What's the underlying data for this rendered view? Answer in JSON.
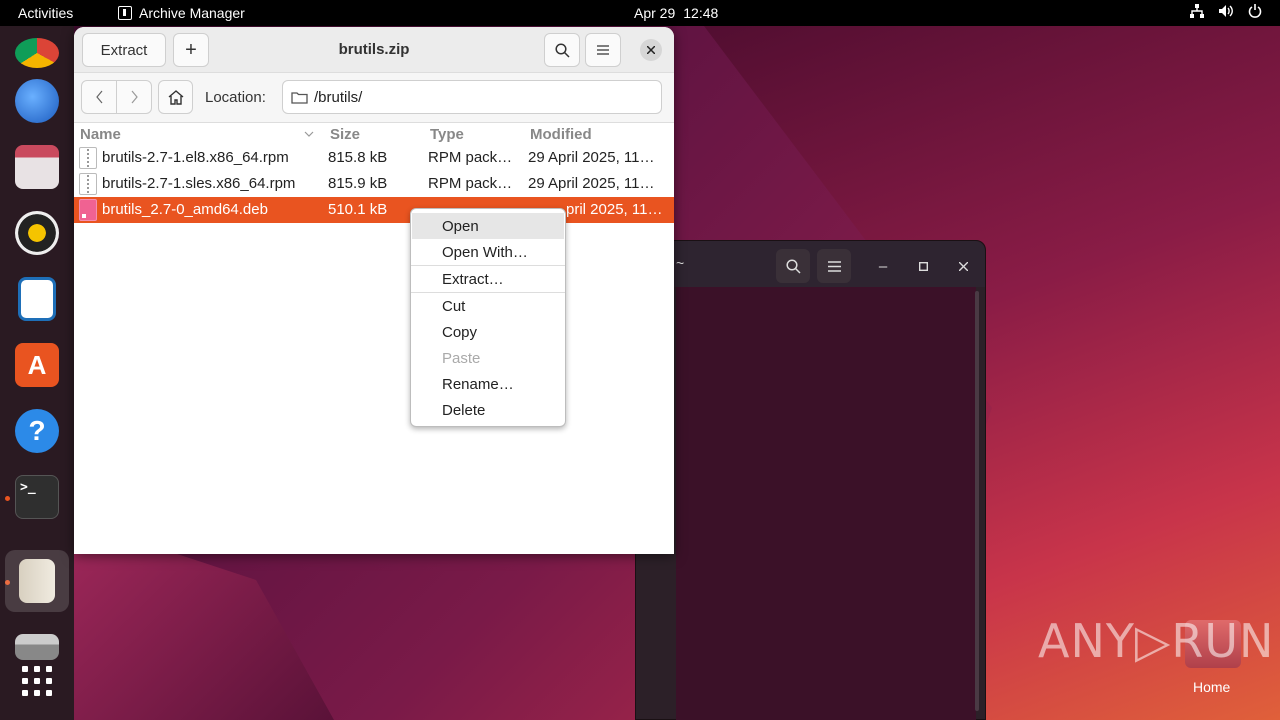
{
  "topbar": {
    "activities": "Activities",
    "app_name": "Archive Manager",
    "date": "Apr 29",
    "time": "12:48",
    "icons": [
      "network-icon",
      "volume-icon",
      "power-icon"
    ]
  },
  "dock": {
    "items": [
      {
        "name": "chrome",
        "icon": "chrome-icon"
      },
      {
        "name": "thunderbird",
        "icon": "thunderbird-icon"
      },
      {
        "name": "files",
        "icon": "files-icon"
      },
      {
        "name": "rhythmbox",
        "icon": "rhythmbox-icon"
      },
      {
        "name": "writer",
        "icon": "writer-icon"
      },
      {
        "name": "software",
        "icon": "software-icon"
      },
      {
        "name": "help",
        "icon": "help-icon"
      },
      {
        "name": "terminal",
        "icon": "terminal-icon",
        "terminal_glyph": ">_"
      },
      {
        "name": "archive-manager",
        "icon": "archive-icon"
      },
      {
        "name": "drive",
        "icon": "drive-icon"
      },
      {
        "name": "app-grid",
        "icon": "app-grid-icon"
      }
    ]
  },
  "archive": {
    "title": "brutils.zip",
    "extract_label": "Extract",
    "add_glyph": "+",
    "location_label": "Location:",
    "location_path": "/brutils/",
    "columns": {
      "name": "Name",
      "size": "Size",
      "type": "Type",
      "modified": "Modified"
    },
    "files": [
      {
        "name": "brutils-2.7-1.el8.x86_64.rpm",
        "size": "815.8 kB",
        "type": "RPM pack…",
        "modified": "29 April 2025, 11…"
      },
      {
        "name": "brutils-2.7-1.sles.x86_64.rpm",
        "size": "815.9 kB",
        "type": "RPM pack…",
        "modified": "29 April 2025, 11…"
      },
      {
        "name": "brutils_2.7-0_amd64.deb",
        "size": "510.1 kB",
        "type": "",
        "modified": "pril 2025, 11…"
      }
    ]
  },
  "context_menu": {
    "open": "Open",
    "open_with": "Open With…",
    "extract": "Extract…",
    "cut": "Cut",
    "copy": "Copy",
    "paste": "Paste",
    "rename": "Rename…",
    "delete": "Delete"
  },
  "terminal": {
    "title_fragment": "~"
  },
  "desktop": {
    "home_label": "Home",
    "watermark": "ANY▷RUN"
  },
  "colors": {
    "accent": "#e95420",
    "topbar": "#000000",
    "selected_row": "#e95420"
  }
}
